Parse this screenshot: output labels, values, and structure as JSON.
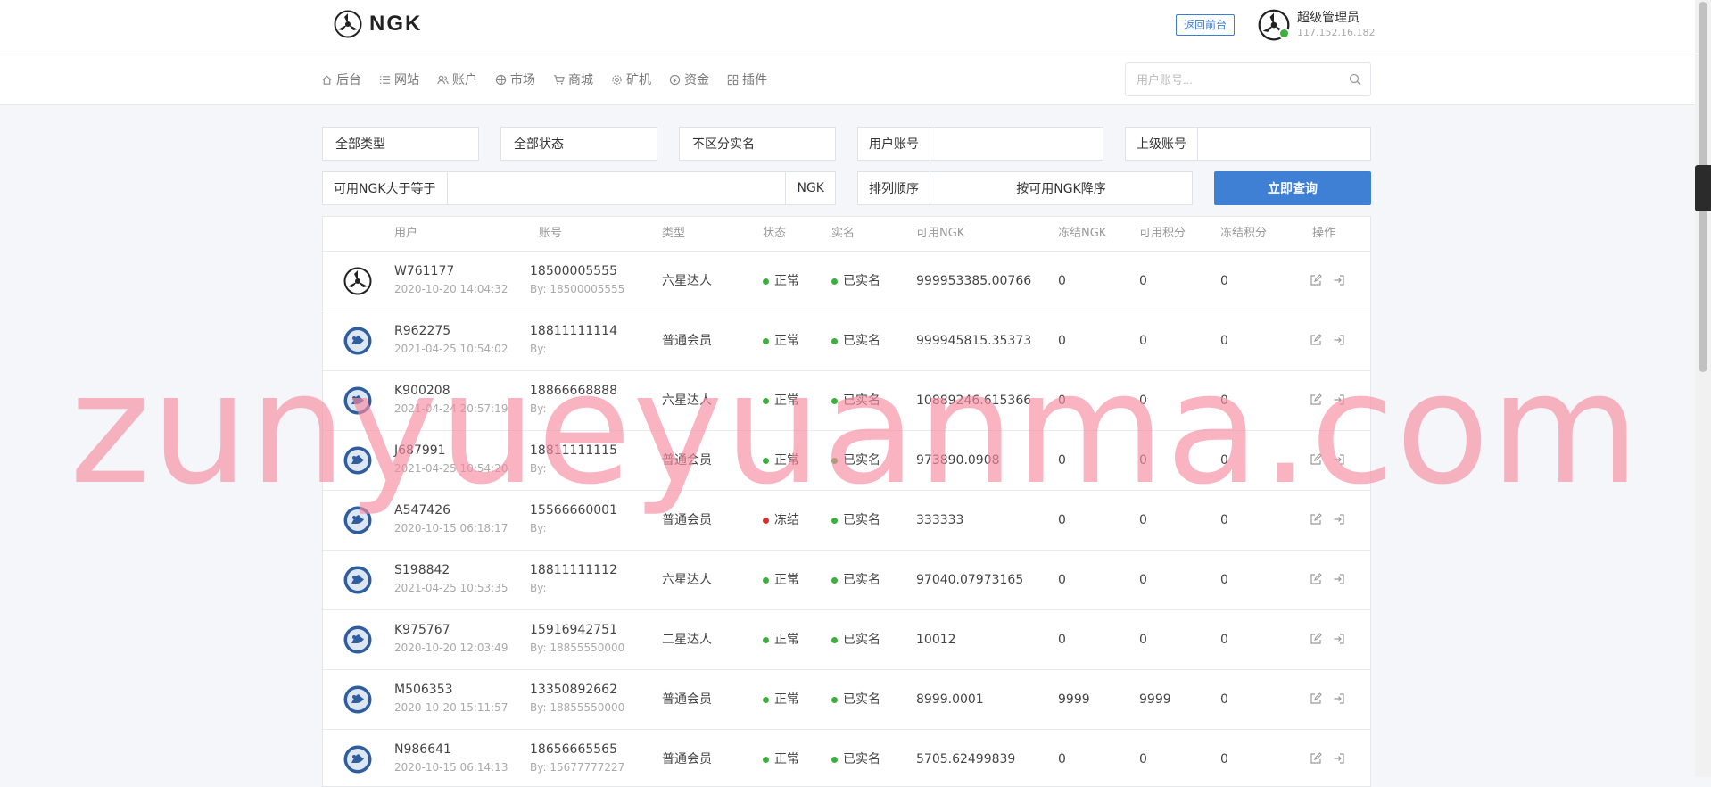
{
  "header": {
    "logo_text": "NGK",
    "back_label": "返回前台",
    "admin_name": "超级管理员",
    "admin_ip": "117.152.16.182"
  },
  "nav": {
    "items": [
      {
        "label": "后台",
        "icon": "home-icon"
      },
      {
        "label": "网站",
        "icon": "list-icon"
      },
      {
        "label": "账户",
        "icon": "users-icon"
      },
      {
        "label": "市场",
        "icon": "globe-icon"
      },
      {
        "label": "商城",
        "icon": "cart-icon"
      },
      {
        "label": "矿机",
        "icon": "cog-icon"
      },
      {
        "label": "资金",
        "icon": "coin-icon"
      },
      {
        "label": "插件",
        "icon": "grid-icon"
      }
    ],
    "search_placeholder": "用户账号..."
  },
  "filters": {
    "type": "全部类型",
    "status": "全部状态",
    "realname": "不区分实名",
    "account_label": "用户账号",
    "parent_label": "上级账号",
    "ngk_min_label": "可用NGK大于等于",
    "ngk_unit": "NGK",
    "sort_label": "排列顺序",
    "sort_value": "按可用NGK降序",
    "query_button": "立即查询"
  },
  "table": {
    "headers": {
      "user": "用户",
      "account": "账号",
      "type": "类型",
      "status": "状态",
      "realname": "实名",
      "ngk": "可用NGK",
      "frozen_ngk": "冻结NGK",
      "points": "可用积分",
      "frozen_points": "冻结积分",
      "ops": "操作"
    },
    "rows": [
      {
        "user": "W761177",
        "time": "2020-10-20 14:04:32",
        "account": "18500005555",
        "by": "By: 18500005555",
        "type": "六星达人",
        "status": "正常",
        "status_color": "#3cb03c",
        "realname": "已实名",
        "ngk": "999953385.00766",
        "frozen_ngk": "0",
        "points": "0",
        "frozen_points": "0",
        "avatar": "ngk-logo"
      },
      {
        "user": "R962275",
        "time": "2021-04-25 10:54:02",
        "account": "18811111114",
        "by": "By:",
        "type": "普通会员",
        "status": "正常",
        "status_color": "#3cb03c",
        "realname": "已实名",
        "ngk": "999945815.35373",
        "frozen_ngk": "0",
        "points": "0",
        "frozen_points": "0",
        "avatar": "blue-circle"
      },
      {
        "user": "K900208",
        "time": "2021-04-24 20:57:19",
        "account": "18866668888",
        "by": "By:",
        "type": "六星达人",
        "status": "正常",
        "status_color": "#3cb03c",
        "realname": "已实名",
        "ngk": "10889246.615366",
        "frozen_ngk": "0",
        "points": "0",
        "frozen_points": "0",
        "avatar": "blue-circle"
      },
      {
        "user": "J687991",
        "time": "2021-04-25 10:54:20",
        "account": "18811111115",
        "by": "By:",
        "type": "普通会员",
        "status": "正常",
        "status_color": "#3cb03c",
        "realname": "已实名",
        "ngk": "973890.0908",
        "frozen_ngk": "0",
        "points": "0",
        "frozen_points": "0",
        "avatar": "blue-circle"
      },
      {
        "user": "A547426",
        "time": "2020-10-15 06:18:17",
        "account": "15566660001",
        "by": "By:",
        "type": "普通会员",
        "status": "冻结",
        "status_color": "#d9302c",
        "realname": "已实名",
        "ngk": "333333",
        "frozen_ngk": "0",
        "points": "0",
        "frozen_points": "0",
        "avatar": "blue-circle"
      },
      {
        "user": "S198842",
        "time": "2021-04-25 10:53:35",
        "account": "18811111112",
        "by": "By:",
        "type": "六星达人",
        "status": "正常",
        "status_color": "#3cb03c",
        "realname": "已实名",
        "ngk": "97040.07973165",
        "frozen_ngk": "0",
        "points": "0",
        "frozen_points": "0",
        "avatar": "blue-circle"
      },
      {
        "user": "K975767",
        "time": "2020-10-20 12:03:49",
        "account": "15916942751",
        "by": "By: 18855550000",
        "type": "二星达人",
        "status": "正常",
        "status_color": "#3cb03c",
        "realname": "已实名",
        "ngk": "10012",
        "frozen_ngk": "0",
        "points": "0",
        "frozen_points": "0",
        "avatar": "blue-circle"
      },
      {
        "user": "M506353",
        "time": "2020-10-20 15:11:57",
        "account": "13350892662",
        "by": "By: 18855550000",
        "type": "普通会员",
        "status": "正常",
        "status_color": "#3cb03c",
        "realname": "已实名",
        "ngk": "8999.0001",
        "frozen_ngk": "9999",
        "points": "9999",
        "frozen_points": "0",
        "avatar": "blue-circle"
      },
      {
        "user": "N986641",
        "time": "2020-10-15 06:14:13",
        "account": "18656665565",
        "by": "By: 15677777227",
        "type": "普通会员",
        "status": "正常",
        "status_color": "#3cb03c",
        "realname": "已实名",
        "ngk": "5705.62499839",
        "frozen_ngk": "0",
        "points": "0",
        "frozen_points": "0",
        "avatar": "blue-circle"
      }
    ]
  },
  "watermark": "zunyueyuanma.com",
  "colors": {
    "accent": "#3f7fd4",
    "ok": "#3cb03c",
    "frozen": "#d9302c"
  }
}
